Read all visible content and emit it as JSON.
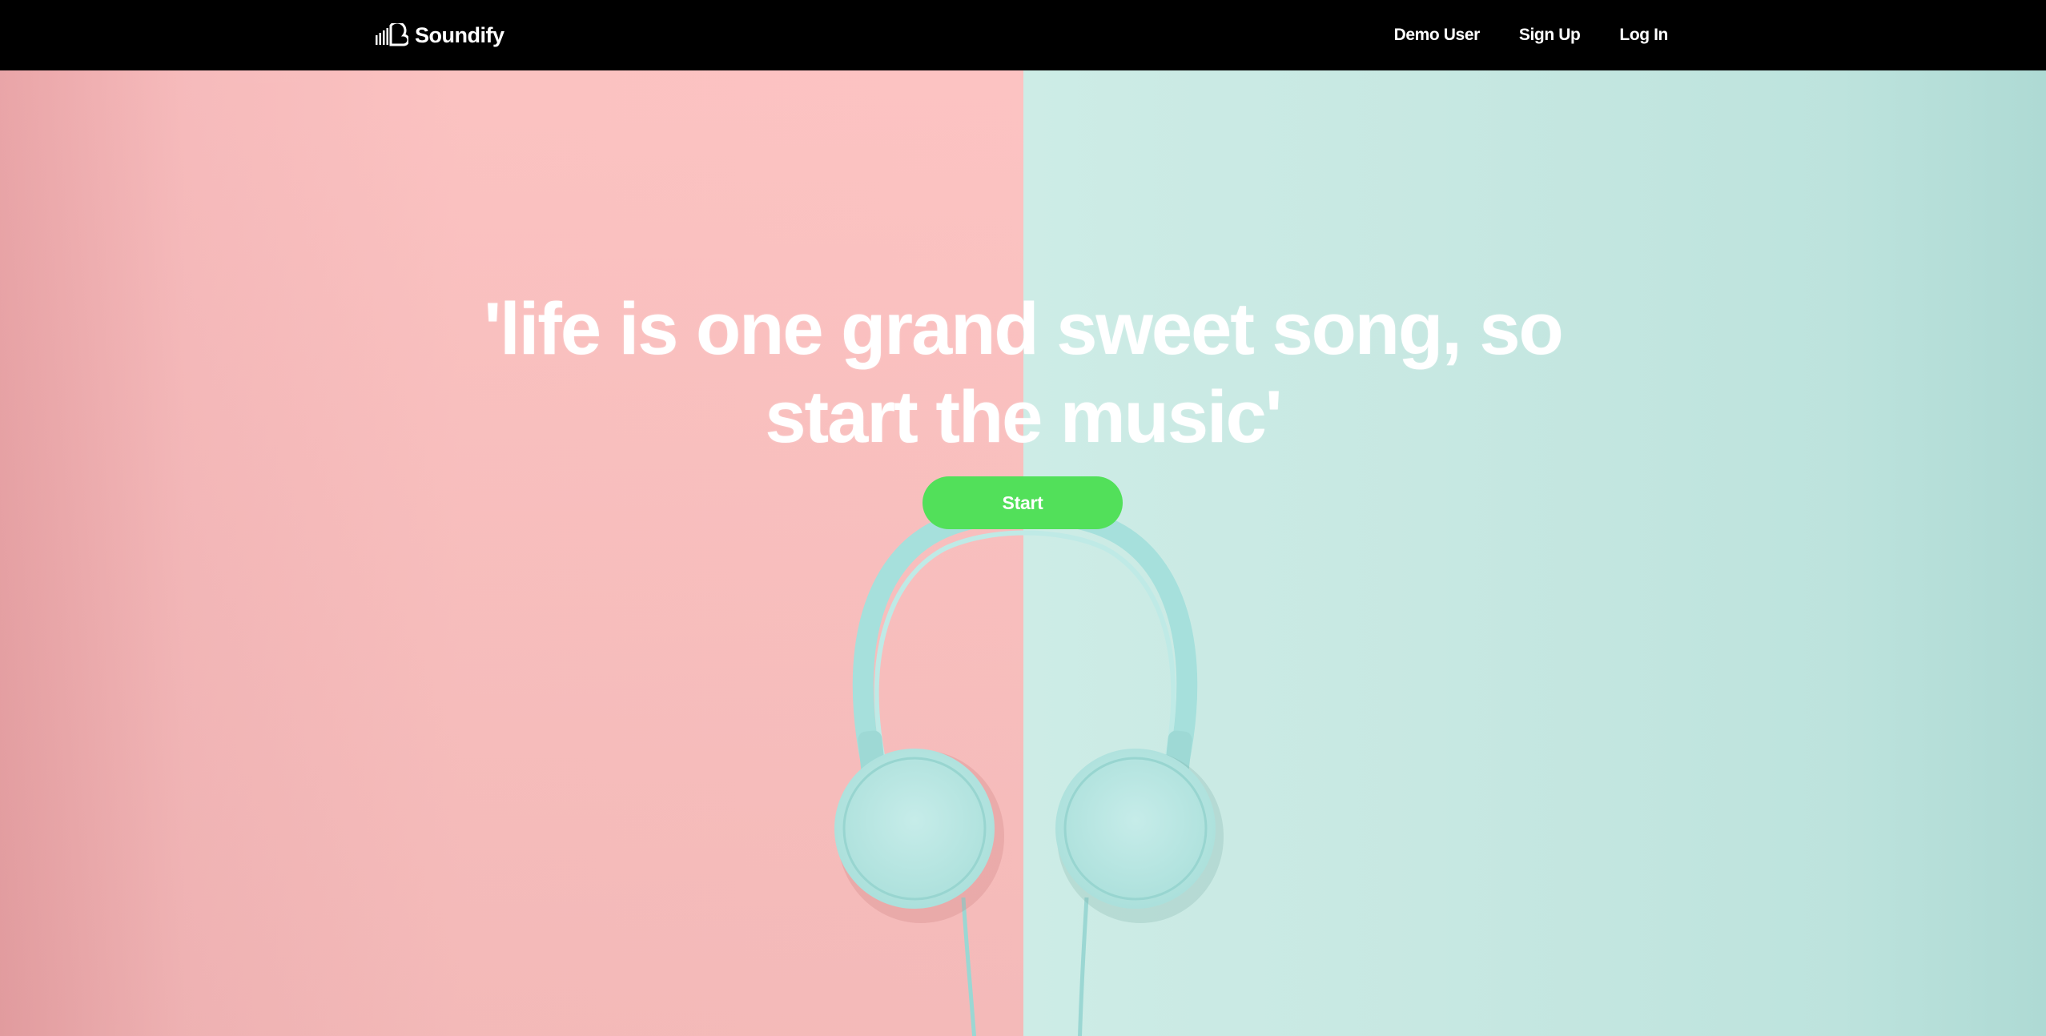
{
  "navbar": {
    "brand_name": "Soundify",
    "brand_icon": "soundcloud-logo-icon",
    "links": [
      {
        "label": "Demo User"
      },
      {
        "label": "Sign Up"
      },
      {
        "label": "Log In"
      }
    ]
  },
  "hero": {
    "quote": "'life is one grand sweet song, so\nstart the music'",
    "start_button_label": "Start",
    "image": "headphones-on-pink-and-mint-background"
  },
  "colors": {
    "navbar_bg": "#000000",
    "accent_green": "#52e05a",
    "bg_pink": "#fcc0bf",
    "bg_mint": "#c7e8e2",
    "headphones_mint": "#a9e0dc",
    "text": "#ffffff"
  }
}
